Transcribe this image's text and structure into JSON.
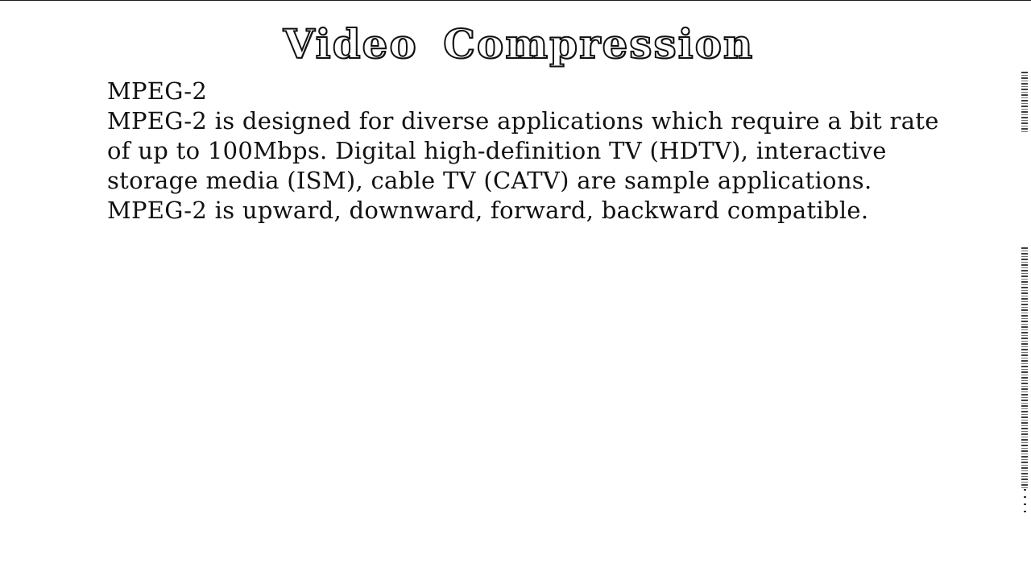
{
  "slide": {
    "title": "Video Compression",
    "lines": [
      "MPEG-2",
      "MPEG-2 is designed for diverse applications which require a bit rate",
      "of up to 100Mbps. Digital high-definition TV (HDTV), interactive",
      "storage media (ISM), cable TV (CATV) are sample applications.",
      "MPEG-2 is upward, downward, forward, backward compatible."
    ]
  }
}
